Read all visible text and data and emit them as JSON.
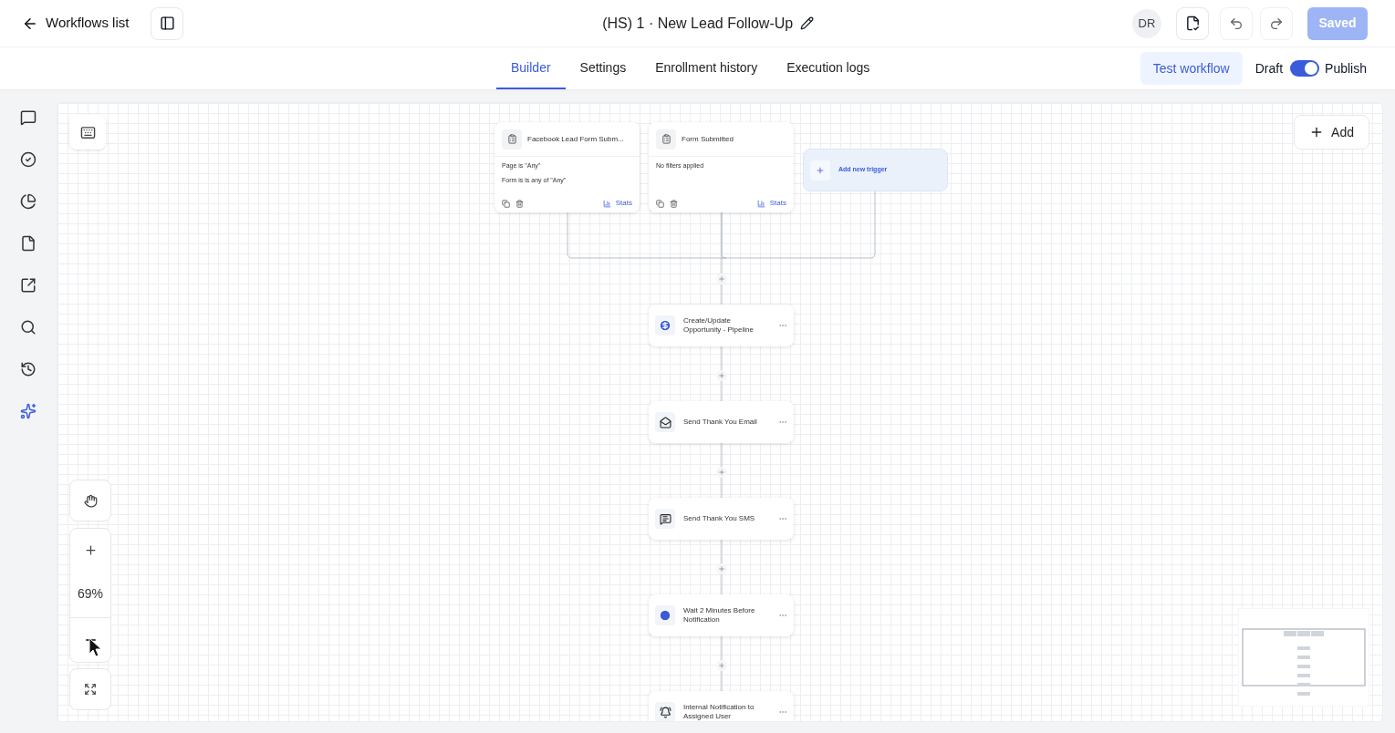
{
  "header": {
    "back_link": "Workflows list",
    "title": "(HS) 1 · New Lead Follow-Up",
    "avatar": "DR",
    "save_button": {
      "label": "Saved",
      "disabled": true
    }
  },
  "tabs": [
    {
      "label": "Builder",
      "selected": true
    },
    {
      "label": "Settings",
      "selected": false
    },
    {
      "label": "Enrollment history",
      "selected": false
    },
    {
      "label": "Execution logs",
      "selected": false
    }
  ],
  "test_button": "Test workflow",
  "publish_toggle": {
    "off_label": "Draft",
    "on_label": "Publish",
    "on": true
  },
  "canvas": {
    "add_button": "Add",
    "zoom": "69%",
    "triggers": [
      {
        "title": "Facebook Lead Form Subm...",
        "filters": [
          "Page is \"Any\"",
          "Form is is any of \"Any\""
        ],
        "stats": "Stats"
      },
      {
        "title": "Form Submitted",
        "filters": [
          "No filters applied"
        ],
        "stats": "Stats"
      }
    ],
    "add_trigger": "Add new trigger",
    "actions": [
      {
        "kind": "opportunity",
        "title": "Create/Update Opportunity - Pipeline"
      },
      {
        "kind": "email",
        "title": "Send Thank You Email"
      },
      {
        "kind": "sms",
        "title": "Send Thank You SMS"
      },
      {
        "kind": "wait",
        "title": "Wait 2 Minutes Before Notification"
      },
      {
        "kind": "notification",
        "title": "Internal Notification to Assigned User"
      }
    ]
  }
}
